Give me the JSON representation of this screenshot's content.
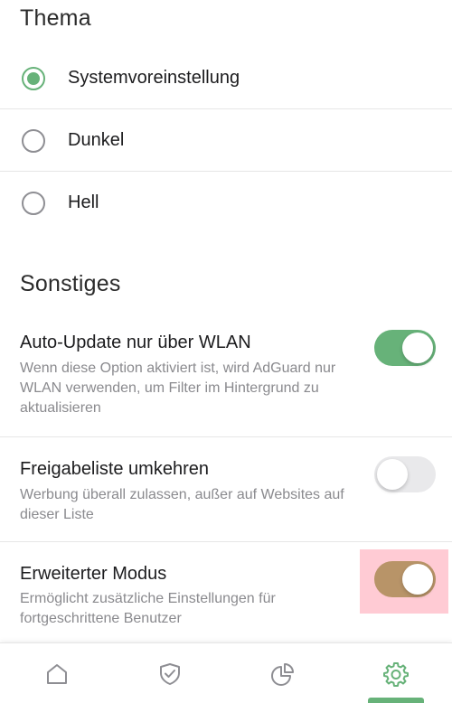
{
  "theme": {
    "title": "Thema",
    "options": [
      {
        "label": "Systemvoreinstellung",
        "selected": true
      },
      {
        "label": "Dunkel",
        "selected": false
      },
      {
        "label": "Hell",
        "selected": false
      }
    ]
  },
  "misc": {
    "title": "Sonstiges",
    "settings": [
      {
        "title": "Auto-Update nur über WLAN",
        "description": "Wenn diese Option aktiviert ist, wird AdGuard nur WLAN verwenden, um Filter im Hintergrund zu aktualisieren",
        "enabled": true
      },
      {
        "title": "Freigabeliste umkehren",
        "description": "Werbung überall zulassen, außer auf Websites auf dieser Liste",
        "enabled": false
      },
      {
        "title": "Erweiterter Modus",
        "description": "Ermöglicht zusätzliche Einstellungen für fortgeschrittene Benutzer",
        "enabled": true
      }
    ]
  },
  "tabbar": {
    "tabs": [
      {
        "icon": "home-icon",
        "active": false
      },
      {
        "icon": "shield-check-icon",
        "active": false
      },
      {
        "icon": "pie-chart-icon",
        "active": false
      },
      {
        "icon": "gear-icon",
        "active": true
      }
    ]
  },
  "colors": {
    "accent": "#67b279",
    "toggle_on": "#67b279",
    "toggle_off": "#e9e9eb",
    "highlight_toggle": "#b89468",
    "text_secondary": "#8a8a8e",
    "icon_inactive": "#8e8e93"
  }
}
